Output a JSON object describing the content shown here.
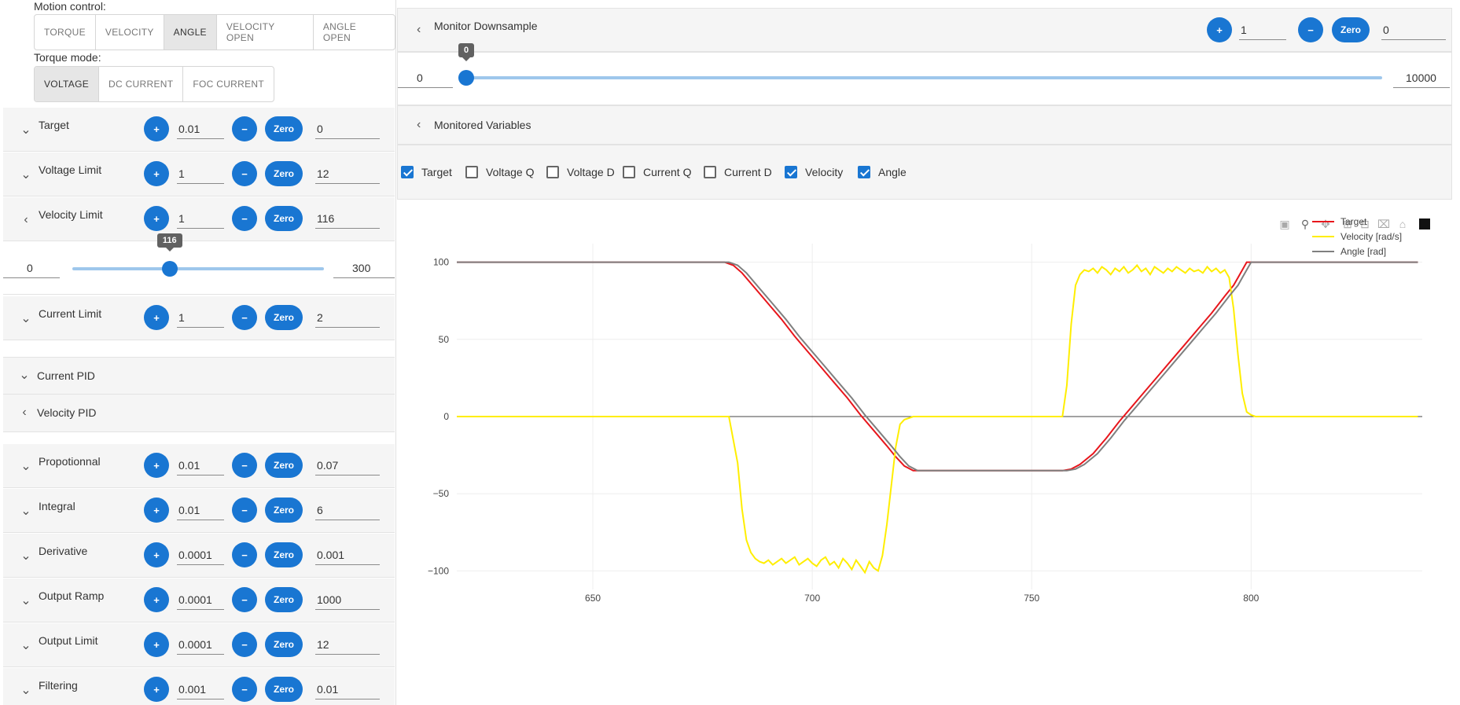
{
  "motion_control": {
    "label": "Motion control:",
    "options": [
      "TORQUE",
      "VELOCITY",
      "ANGLE",
      "VELOCITY OPEN",
      "ANGLE OPEN"
    ],
    "selected": "ANGLE"
  },
  "torque_mode": {
    "label": "Torque mode:",
    "options": [
      "VOLTAGE",
      "DC CURRENT",
      "FOC CURRENT"
    ],
    "selected": "VOLTAGE"
  },
  "controls": {
    "plus": "+",
    "minus": "−",
    "zero": "Zero"
  },
  "params": {
    "target": {
      "label": "Target",
      "step": "0.01",
      "value": "0"
    },
    "voltage_limit": {
      "label": "Voltage Limit",
      "step": "1",
      "value": "12"
    },
    "velocity_limit": {
      "label": "Velocity Limit",
      "step": "1",
      "value": "116",
      "slider_min": "0",
      "slider_max": "300",
      "slider_value": "116",
      "slider_fraction": 0.387
    },
    "current_limit": {
      "label": "Current Limit",
      "step": "1",
      "value": "2"
    },
    "proportional": {
      "label": "Propotionnal",
      "step": "0.01",
      "value": "0.07"
    },
    "integral": {
      "label": "Integral",
      "step": "0.01",
      "value": "6"
    },
    "derivative": {
      "label": "Derivative",
      "step": "0.0001",
      "value": "0.001"
    },
    "output_ramp": {
      "label": "Output Ramp",
      "step": "0.0001",
      "value": "1000"
    },
    "output_limit": {
      "label": "Output Limit",
      "step": "0.0001",
      "value": "12"
    },
    "filtering": {
      "label": "Filtering",
      "step": "0.001",
      "value": "0.01"
    }
  },
  "sections": {
    "current_pid": "Current PID",
    "velocity_pid": "Velocity PID"
  },
  "monitor_downsample": {
    "label": "Monitor Downsample",
    "step": "1",
    "value": "0",
    "slider_min": "0",
    "slider_max": "10000",
    "slider_value": "0",
    "slider_fraction": 0.0
  },
  "monitored_variables": {
    "label": "Monitored Variables",
    "items": [
      {
        "label": "Target",
        "checked": true
      },
      {
        "label": "Voltage Q",
        "checked": false
      },
      {
        "label": "Voltage D",
        "checked": false
      },
      {
        "label": "Current Q",
        "checked": false
      },
      {
        "label": "Current D",
        "checked": false
      },
      {
        "label": "Velocity",
        "checked": true
      },
      {
        "label": "Angle",
        "checked": true
      }
    ]
  },
  "plot_toolbar": [
    "camera-icon",
    "zoom-icon",
    "pan-icon",
    "zoom-in-icon",
    "zoom-out-icon",
    "autoscale-icon",
    "reset-axes-icon",
    "plotly-logo-icon"
  ],
  "colors": {
    "accent": "#1976d2",
    "target": "#e8161c",
    "velocity": "#ffee00",
    "angle": "#7f7f7f"
  },
  "chart_data": {
    "type": "line",
    "x_range": [
      619,
      839
    ],
    "y_range": [
      -112,
      112
    ],
    "xticks": [
      "650",
      "700",
      "750",
      "800"
    ],
    "yticks": [
      "100",
      "50",
      "0",
      "−50",
      "−100"
    ],
    "legend_position": "top-right",
    "series": [
      {
        "name": "Target",
        "color": "#e8161c",
        "x": [
          619,
          680,
          682,
          684,
          687,
          690,
          693,
          696,
          699,
          702,
          705,
          708,
          711,
          714,
          717,
          719,
          721,
          723,
          757,
          759,
          761,
          764,
          767,
          770,
          773,
          776,
          779,
          782,
          785,
          788,
          791,
          794,
          796,
          797,
          799,
          838
        ],
        "y": [
          100,
          100,
          98,
          93,
          83,
          73,
          63,
          52,
          42,
          32,
          22,
          12,
          1,
          -9,
          -19,
          -26,
          -32,
          -35,
          -35,
          -34,
          -31,
          -24,
          -14,
          -3,
          7,
          17,
          27,
          37,
          47,
          57,
          67,
          78,
          85,
          90,
          100,
          100
        ]
      },
      {
        "name": "Velocity [rad/s]",
        "color": "#ffee00",
        "x": [
          619,
          681,
          683,
          684,
          685,
          686,
          687,
          688,
          689,
          690,
          691,
          692,
          693,
          694,
          695,
          696,
          697,
          698,
          699,
          700,
          701,
          702,
          703,
          704,
          705,
          706,
          707,
          708,
          709,
          710,
          711,
          712,
          713,
          714,
          715,
          716,
          717,
          718,
          719,
          720,
          721,
          722,
          723,
          724,
          725,
          726,
          727,
          728,
          757,
          758,
          759,
          760,
          761,
          762,
          763,
          764,
          765,
          766,
          767,
          768,
          769,
          770,
          771,
          772,
          773,
          774,
          775,
          776,
          777,
          778,
          779,
          780,
          781,
          782,
          783,
          784,
          785,
          786,
          787,
          788,
          789,
          790,
          791,
          792,
          793,
          794,
          795,
          796,
          797,
          798,
          799,
          800,
          801,
          838
        ],
        "y": [
          0,
          0,
          -30,
          -60,
          -80,
          -88,
          -92,
          -94,
          -95,
          -93,
          -96,
          -94,
          -92,
          -95,
          -93,
          -91,
          -96,
          -94,
          -92,
          -95,
          -97,
          -93,
          -91,
          -96,
          -94,
          -98,
          -92,
          -95,
          -99,
          -93,
          -97,
          -101,
          -94,
          -98,
          -100,
          -90,
          -70,
          -45,
          -20,
          -5,
          -2,
          -1,
          0,
          0,
          0,
          0,
          0,
          0,
          0,
          20,
          60,
          85,
          92,
          95,
          94,
          96,
          93,
          97,
          95,
          92,
          96,
          94,
          97,
          93,
          95,
          98,
          94,
          96,
          92,
          97,
          95,
          93,
          96,
          94,
          97,
          95,
          93,
          96,
          94,
          95,
          93,
          97,
          94,
          96,
          93,
          95,
          90,
          70,
          40,
          15,
          3,
          1,
          0,
          0
        ]
      },
      {
        "name": "Angle [rad]",
        "color": "#7f7f7f",
        "x": [
          619,
          681,
          683,
          685,
          688,
          691,
          694,
          697,
          700,
          703,
          706,
          709,
          712,
          715,
          718,
          720,
          722,
          724,
          758,
          760,
          762,
          765,
          768,
          771,
          774,
          777,
          780,
          783,
          786,
          789,
          792,
          795,
          797,
          798,
          800,
          838
        ],
        "y": [
          100,
          100,
          98,
          93,
          83,
          73,
          63,
          52,
          42,
          32,
          22,
          12,
          1,
          -9,
          -19,
          -26,
          -32,
          -35,
          -35,
          -34,
          -31,
          -24,
          -14,
          -3,
          7,
          17,
          27,
          37,
          47,
          57,
          67,
          78,
          85,
          90,
          100,
          100
        ]
      }
    ],
    "zero_line": {
      "color": "#444444",
      "y": 0
    }
  }
}
